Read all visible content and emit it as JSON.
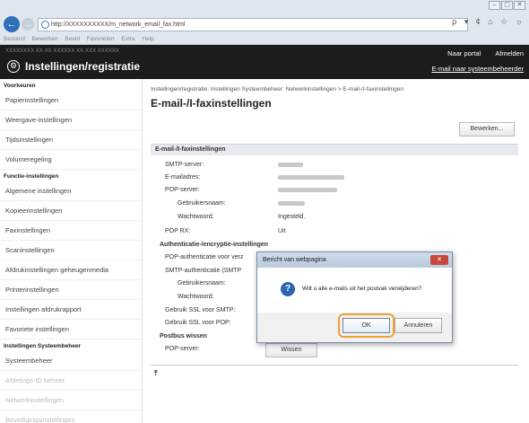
{
  "browser": {
    "window_buttons": [
      "–",
      "▢",
      "✕"
    ],
    "url": "http://XXXXXXXXXX/m_network_email_fax.html",
    "url_actions": "ρ ▾ ¢ ⌂ ☆ ☼",
    "menu": [
      "Bestand",
      "Bewerken",
      "Beeld",
      "Favorieten",
      "Extra",
      "Help"
    ]
  },
  "header": {
    "top_left": "XXXXXXXX  XX-XX  XXXXXX XX-XXX  XXXXXX",
    "title": "Instellingen/registratie",
    "portal_link": "Naar portal",
    "logout_link": "Afmelden",
    "mail_admin_link": "E-mail naar systeembeheerder"
  },
  "sidebar": {
    "groups": [
      {
        "heading": "Voorkeuren",
        "items": [
          "Papierinstellingen",
          "Weergave-instellingen",
          "Tijdsinstellingen",
          "Volumeregeling"
        ]
      },
      {
        "heading": "Functie-instellingen",
        "items": [
          "Algemene instellingen",
          "Kopieerinstellingen",
          "Faxinstellingen",
          "Scaninstellingen",
          "Afdrukinstellingen geheugenmedia",
          "Printerinstellingen",
          "Instellingen afdrukrapport",
          "Favoriete instellingen"
        ]
      },
      {
        "heading": "Instellingen Systeembeheer",
        "items": [
          "Systeembeheer",
          "Afdelings-ID beheer",
          "Netwerkinstellingen",
          "Beveiligingsinstellingen"
        ]
      }
    ]
  },
  "main": {
    "breadcrumb": "Instellingen/registratie: Instellingen Systeembeheer: Netwerkinstellingen > E-mail-/I-faxinstellingen",
    "title": "E-mail-/I-faxinstellingen",
    "edit_button": "Bewerken...",
    "section": "E-mail-/I-faxinstellingen",
    "rows": {
      "smtp_server": "SMTP-server:",
      "email_address": "E-mailadres:",
      "pop_server": "POP-server:",
      "username": "Gebruikersnaam:",
      "password": "Wachtwoord:",
      "password_value": "Ingesteld.",
      "pop_rx": "POP RX:",
      "pop_rx_value": "Uit",
      "auth_heading": "Authenticatie-/encryptie-instellingen",
      "pop_auth": "POP-authenticatie voor verz",
      "smtp_auth": "SMTP-authenticatie (SMTP",
      "username2": "Gebruikersnaam:",
      "password2": "Wachtwoord:",
      "ssl_smtp": "Gebruik SSL voor SMTP:",
      "ssl_pop": "Gebruik SSL voor POP:",
      "postbox_heading": "Postbus wissen",
      "pop_server2": "POP-server:"
    },
    "wissen_button": "Wissen",
    "to_top": "⤒"
  },
  "dialog": {
    "title": "Bericht van webpagina",
    "close": "✕",
    "icon": "?",
    "message": "Wilt u alle e-mails uit het postvak verwijderen?",
    "ok": "OK",
    "cancel": "Annuleren"
  }
}
